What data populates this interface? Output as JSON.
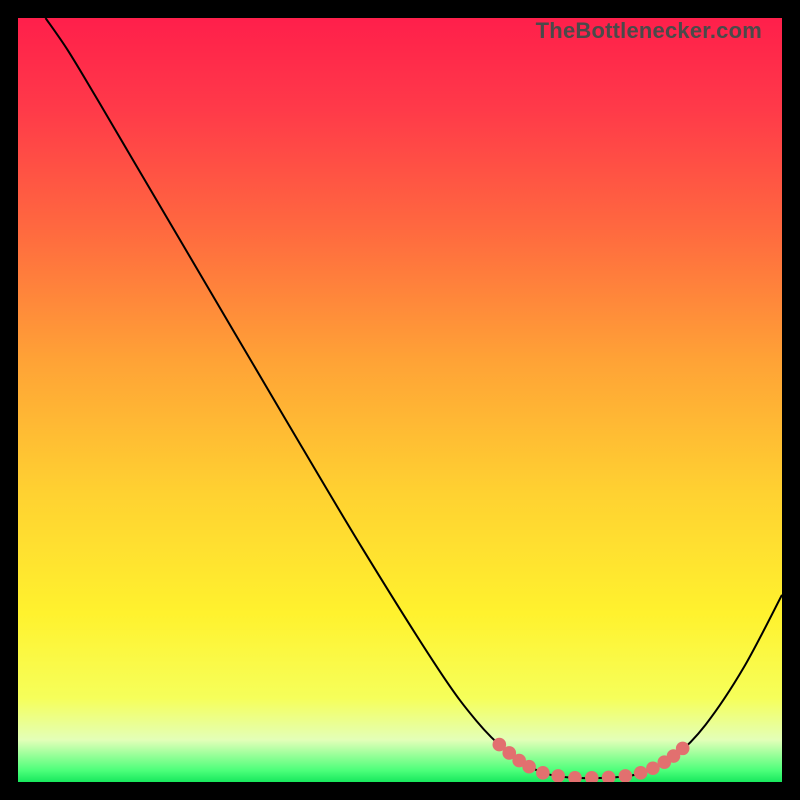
{
  "watermark": "TheBottlenecker.com",
  "chart_data": {
    "type": "line",
    "title": "",
    "xlabel": "",
    "ylabel": "",
    "xlim": [
      0,
      100
    ],
    "ylim": [
      0,
      100
    ],
    "grid": false,
    "legend": null,
    "gradient_stops": [
      {
        "offset": 0,
        "color": "#ff1f4b"
      },
      {
        "offset": 0.12,
        "color": "#ff3a49"
      },
      {
        "offset": 0.28,
        "color": "#ff6a3f"
      },
      {
        "offset": 0.45,
        "color": "#ffa336"
      },
      {
        "offset": 0.62,
        "color": "#ffd131"
      },
      {
        "offset": 0.78,
        "color": "#fff22e"
      },
      {
        "offset": 0.89,
        "color": "#f6ff5a"
      },
      {
        "offset": 0.945,
        "color": "#e3ffb8"
      },
      {
        "offset": 0.985,
        "color": "#4cff7a"
      },
      {
        "offset": 1.0,
        "color": "#18e85d"
      }
    ],
    "series": [
      {
        "name": "bottleneck-curve",
        "color": "#000000",
        "points": [
          {
            "x": 3.6,
            "y": 100.0
          },
          {
            "x": 6.5,
            "y": 95.8
          },
          {
            "x": 10.0,
            "y": 90.0
          },
          {
            "x": 15.0,
            "y": 81.5
          },
          {
            "x": 25.0,
            "y": 64.5
          },
          {
            "x": 35.0,
            "y": 47.5
          },
          {
            "x": 45.0,
            "y": 30.7
          },
          {
            "x": 55.0,
            "y": 14.8
          },
          {
            "x": 60.0,
            "y": 8.0
          },
          {
            "x": 64.0,
            "y": 4.0
          },
          {
            "x": 68.0,
            "y": 1.5
          },
          {
            "x": 72.0,
            "y": 0.6
          },
          {
            "x": 78.0,
            "y": 0.6
          },
          {
            "x": 82.0,
            "y": 1.3
          },
          {
            "x": 86.0,
            "y": 3.4
          },
          {
            "x": 90.0,
            "y": 7.5
          },
          {
            "x": 95.0,
            "y": 15.0
          },
          {
            "x": 100.0,
            "y": 24.5
          }
        ]
      },
      {
        "name": "bottleneck-markers",
        "color": "#e2706f",
        "marker": "circle",
        "points": [
          {
            "x": 63.0,
            "y": 4.9
          },
          {
            "x": 64.3,
            "y": 3.8
          },
          {
            "x": 65.6,
            "y": 2.8
          },
          {
            "x": 66.9,
            "y": 2.0
          },
          {
            "x": 68.7,
            "y": 1.2
          },
          {
            "x": 70.7,
            "y": 0.8
          },
          {
            "x": 72.9,
            "y": 0.55
          },
          {
            "x": 75.1,
            "y": 0.55
          },
          {
            "x": 77.3,
            "y": 0.6
          },
          {
            "x": 79.5,
            "y": 0.8
          },
          {
            "x": 81.5,
            "y": 1.2
          },
          {
            "x": 83.1,
            "y": 1.8
          },
          {
            "x": 84.6,
            "y": 2.6
          },
          {
            "x": 85.8,
            "y": 3.4
          },
          {
            "x": 87.0,
            "y": 4.4
          }
        ]
      }
    ]
  }
}
